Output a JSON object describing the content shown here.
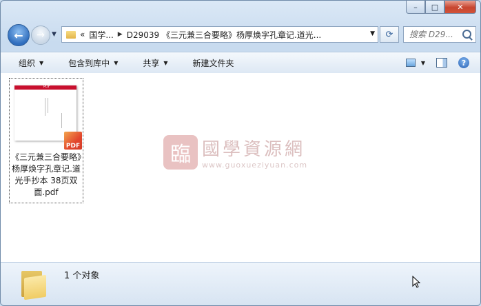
{
  "window": {
    "caption": {
      "minimize": "–",
      "maximize": "□",
      "close": "✕"
    }
  },
  "nav": {
    "back_symbol": "←",
    "forward_symbol": "→",
    "breadcrumb_prefix": "«",
    "crumbs": [
      "国学...",
      "D29039 《三元兼三合要略》杨厚焕字孔章记.道光..."
    ],
    "refresh_symbol": "⟳",
    "search_placeholder": "搜索 D29..."
  },
  "toolbar": {
    "organize": "组织",
    "include_library": "包含到库中",
    "share": "共享",
    "new_folder": "新建文件夹"
  },
  "files": [
    {
      "name": "《三元兼三合要略》杨厚焕字孔章记.道光手抄本 38页双面.pdf",
      "thumb_header": "PDF",
      "badge": "PDF"
    }
  ],
  "watermark": {
    "logo_char": "臨",
    "title": "國學資源網",
    "url": "www.guoxueziyuan.com"
  },
  "status": {
    "count_text": "1 个对象"
  }
}
